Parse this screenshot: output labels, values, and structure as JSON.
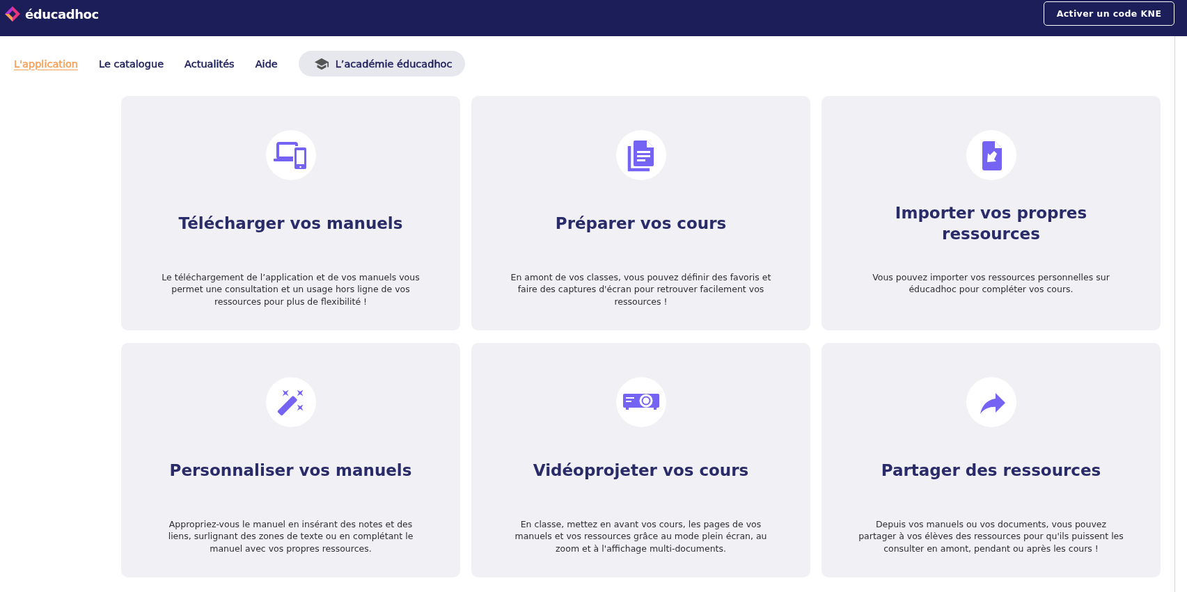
{
  "header": {
    "logo": "éducadhoc",
    "button": "Activer un code KNE"
  },
  "nav": [
    {
      "label": "L'application",
      "kind": "link",
      "selected": true
    },
    {
      "label": "Le catalogue",
      "kind": "link",
      "selected": false
    },
    {
      "label": "Actualités",
      "kind": "link",
      "selected": false
    },
    {
      "label": "Aide",
      "kind": "link",
      "selected": false
    },
    {
      "label": "L’académie éducadhoc",
      "kind": "pill",
      "selected": false
    }
  ],
  "cards": [
    {
      "title": "Télécharger vos manuels",
      "description": "Le téléchargement de l’application et de vos manuels vous permet une consultation et un usage hors ligne de vos ressources pour plus de flexibilité !"
    },
    {
      "title": "Préparer vos cours",
      "description": "En amont de vos classes, vous pouvez définir des favoris et faire des captures d'écran pour retrouver facilement vos ressources !"
    },
    {
      "title": "Importer vos propres ressources",
      "description": "Vous pouvez importer vos ressources personnelles sur éducadhoc pour compléter vos cours."
    },
    {
      "title": "Personnaliser vos manuels",
      "description": "Appropriez-vous le manuel en insérant des notes et des liens, surlignant des zones de texte ou en complétant le manuel avec vos propres ressources."
    },
    {
      "title": "Vidéoprojeter vos cours",
      "description": "En classe, mettez en avant vos cours, les pages de vos manuels et vos ressources grâce au mode plein écran, au zoom et à l'affichage multi-documents."
    },
    {
      "title": "Partager des ressources",
      "description": "Depuis vos manuels ou vos documents, vous pouvez partager à vos élèves des ressources pour qu'ils puissent les consulter en amont, pendant ou après les cours !"
    }
  ]
}
